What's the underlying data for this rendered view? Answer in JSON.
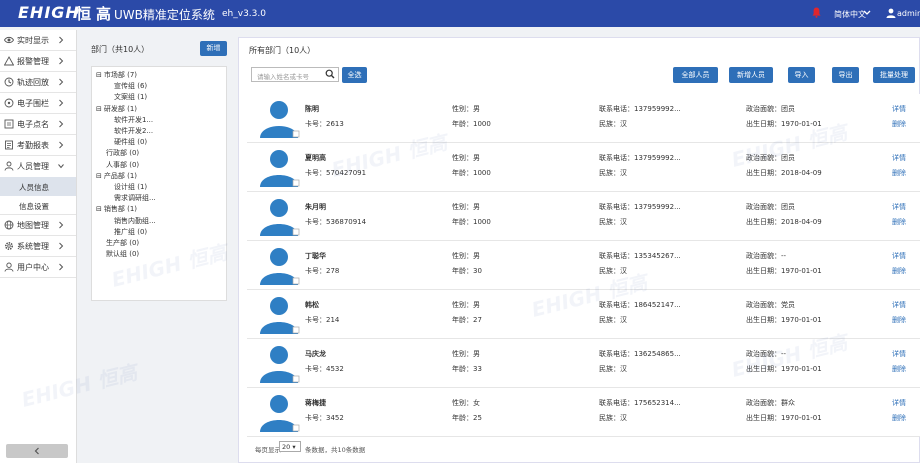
{
  "header": {
    "logo": "EHIGH",
    "logo_cn": "恒高",
    "system_title": "UWB精准定位系统",
    "version": "eh_v3.3.0",
    "language": "简体中文",
    "user": "admin"
  },
  "colors": {
    "brand": "#2b4aa8",
    "button": "#2e6fb8",
    "alert": "#e0262c",
    "avatar": "#2f7fc4"
  },
  "nav": {
    "items": [
      {
        "label": "实时显示",
        "icon": "eye-icon"
      },
      {
        "label": "报警管理",
        "icon": "warning-triangle-icon"
      },
      {
        "label": "轨迹回放",
        "icon": "track-icon"
      },
      {
        "label": "电子围栏",
        "icon": "circle-icon"
      },
      {
        "label": "电子点名",
        "icon": "roll-call-icon"
      },
      {
        "label": "考勤报表",
        "icon": "report-icon"
      },
      {
        "label": "人员管理",
        "icon": "users-icon"
      },
      {
        "label": "地图管理",
        "icon": "globe-icon"
      },
      {
        "label": "系统管理",
        "icon": "gear-icon"
      },
      {
        "label": "用户中心",
        "icon": "user-icon"
      }
    ],
    "sub_items": [
      "人员信息",
      "信息设置"
    ]
  },
  "dept": {
    "title": "部门（共10人）",
    "new_button": "新增",
    "tree": [
      {
        "label": "市场部 (7)",
        "level": 0,
        "toggle": "⊟"
      },
      {
        "label": "宣传组 (6)",
        "level": 1,
        "toggle": ""
      },
      {
        "label": "文案组 (1)",
        "level": 1,
        "toggle": ""
      },
      {
        "label": "研发部 (1)",
        "level": 0,
        "toggle": "⊟"
      },
      {
        "label": "软件开发1...",
        "level": 1,
        "toggle": ""
      },
      {
        "label": "软件开发2...",
        "level": 1,
        "toggle": ""
      },
      {
        "label": "硬件组 (0)",
        "level": 1,
        "toggle": ""
      },
      {
        "label": "行政部 (0)",
        "level": 0,
        "toggle": ""
      },
      {
        "label": "人事部 (0)",
        "level": 0,
        "toggle": ""
      },
      {
        "label": "产品部 (1)",
        "level": 0,
        "toggle": "⊟"
      },
      {
        "label": "设计组 (1)",
        "level": 1,
        "toggle": ""
      },
      {
        "label": "需求调研组...",
        "level": 1,
        "toggle": ""
      },
      {
        "label": "销售部 (1)",
        "level": 0,
        "toggle": "⊟"
      },
      {
        "label": "销售内勤组...",
        "level": 1,
        "toggle": ""
      },
      {
        "label": "推广组 (0)",
        "level": 1,
        "toggle": ""
      },
      {
        "label": "生产部 (0)",
        "level": 0,
        "toggle": ""
      },
      {
        "label": "默认组 (0)",
        "level": 0,
        "toggle": ""
      }
    ]
  },
  "main": {
    "title": "所有部门（10人）",
    "search_placeholder": "请输入姓名或卡号",
    "buttons": {
      "select_all": "全选",
      "all_people": "全部人员",
      "add_person": "新增人员",
      "import": "导入",
      "export": "导出",
      "batch": "批量处理"
    },
    "field_labels": {
      "gender": "性别：",
      "card": "卡号：",
      "age": "年龄：",
      "phone": "联系电话：",
      "ethnicity": "民族：",
      "politics": "政治面貌：",
      "birth": "出生日期："
    },
    "actions": {
      "detail": "详情",
      "delete": "删除"
    },
    "people": [
      {
        "name": "陈明",
        "card": "2613",
        "gender": "男",
        "age": "1000",
        "phone": "137959992...",
        "ethnicity": "汉",
        "politics": "团员",
        "birth": "1970-01-01"
      },
      {
        "name": "夏明高",
        "card": "570427091",
        "gender": "男",
        "age": "1000",
        "phone": "137959992...",
        "ethnicity": "汉",
        "politics": "团员",
        "birth": "2018-04-09"
      },
      {
        "name": "朱月明",
        "card": "536870914",
        "gender": "男",
        "age": "1000",
        "phone": "137959992...",
        "ethnicity": "汉",
        "politics": "团员",
        "birth": "2018-04-09"
      },
      {
        "name": "丁聪华",
        "card": "278",
        "gender": "男",
        "age": "30",
        "phone": "135345267...",
        "ethnicity": "汉",
        "politics": "--",
        "birth": "1970-01-01"
      },
      {
        "name": "韩松",
        "card": "214",
        "gender": "男",
        "age": "27",
        "phone": "186452147...",
        "ethnicity": "汉",
        "politics": "党员",
        "birth": "1970-01-01"
      },
      {
        "name": "马庆龙",
        "card": "4532",
        "gender": "男",
        "age": "33",
        "phone": "136254865...",
        "ethnicity": "汉",
        "politics": "--",
        "birth": "1970-01-01"
      },
      {
        "name": "蒋梅捷",
        "card": "3452",
        "gender": "女",
        "age": "25",
        "phone": "175652314...",
        "ethnicity": "汉",
        "politics": "群众",
        "birth": "1970-01-01"
      }
    ],
    "pager": {
      "prefix": "每页显示",
      "page_size": "20",
      "suffix": "条数据，共10条数据"
    }
  }
}
